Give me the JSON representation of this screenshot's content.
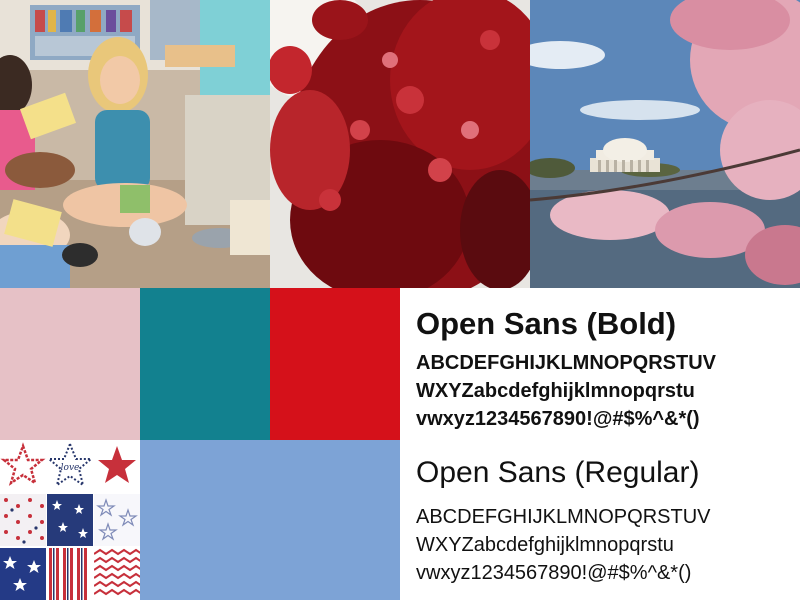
{
  "palette": {
    "pink": "#e6c1c6",
    "teal": "#12818f",
    "red": "#d5111a",
    "blue": "#7da3d6"
  },
  "photos": [
    {
      "id": "kids-reading",
      "subject": "children reading books"
    },
    {
      "id": "red-blossoms",
      "subject": "red blossom branches"
    },
    {
      "id": "memorial",
      "subject": "domed memorial with cherry blossoms"
    }
  ],
  "patterns": {
    "icons": [
      "star-outline-icon",
      "star-text-icon",
      "star-solid-icon",
      "red-dots-pattern",
      "navy-stars-pattern",
      "outline-stars-pattern",
      "navy-white-stars-pattern",
      "stripes-pattern",
      "zigzag-pattern"
    ],
    "badge_text": "love"
  },
  "typography": {
    "bold": {
      "title": "Open Sans (Bold)",
      "line1": "ABCDEFGHIJKLMNOPQRSTUV",
      "line2": "WXYZabcdefghijklmnopqrstu",
      "line3": "vwxyz1234567890!@#$%^&*()"
    },
    "regular": {
      "title": "Open Sans (Regular)",
      "line1": "ABCDEFGHIJKLMNOPQRSTUV",
      "line2": "WXYZabcdefghijklmnopqrstu",
      "line3": "vwxyz1234567890!@#$%^&*()"
    }
  }
}
